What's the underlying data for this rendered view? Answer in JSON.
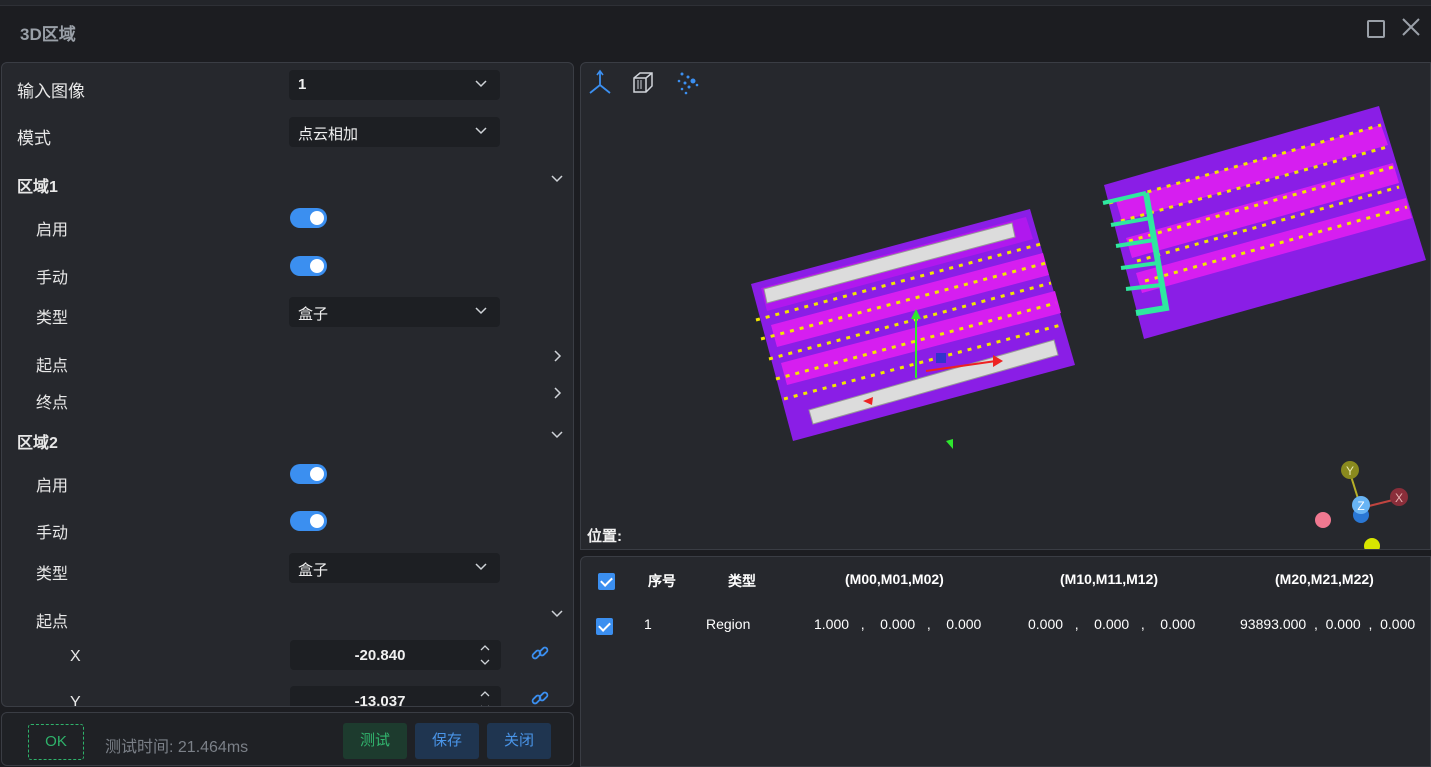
{
  "window": {
    "title": "3D区域"
  },
  "form": {
    "input_image": {
      "label": "输入图像",
      "value": "1"
    },
    "mode": {
      "label": "模式",
      "value": "点云相加"
    },
    "region1": {
      "label": "区域1",
      "enable_label": "启用",
      "enable": true,
      "manual_label": "手动",
      "manual": true,
      "type_label": "类型",
      "type_value": "盒子",
      "start_label": "起点",
      "end_label": "终点"
    },
    "region2": {
      "label": "区域2",
      "enable_label": "启用",
      "enable": true,
      "manual_label": "手动",
      "manual": true,
      "type_label": "类型",
      "type_value": "盒子",
      "start_label": "起点",
      "x_label": "X",
      "x_value": "-20.840",
      "y_label": "Y",
      "y_value": "-13.037"
    }
  },
  "footer": {
    "ok_label": "OK",
    "timing_text": "测试时间: 21.464ms",
    "test_label": "测试",
    "save_label": "保存",
    "close_label": "关闭"
  },
  "viewer": {
    "position_label": "位置:",
    "toolbar_icons": [
      "axis-icon",
      "cube-icon",
      "point-cloud-icon"
    ],
    "axis_labels": {
      "x": "X",
      "y": "Y",
      "z": "Z"
    }
  },
  "table": {
    "headers": {
      "index": "序号",
      "type": "类型",
      "m0": "(M00,M01,M02)",
      "m1": "(M10,M11,M12)",
      "m2": "(M20,M21,M22)"
    },
    "rows": [
      {
        "index": "1",
        "type": "Region",
        "m0": "1.000   ,    0.000   ,    0.000",
        "m1": "0.000   ,    0.000   ,    0.000",
        "m2": "93893.000  ,  0.000  ,  0.000"
      }
    ]
  },
  "colors": {
    "accent": "#3b8ff0",
    "ok_green": "#2fb36b",
    "point_cloud_purple": "#8a1ee6",
    "point_cloud_magenta": "#e21ef0",
    "marker_yellow": "#f2e600"
  }
}
